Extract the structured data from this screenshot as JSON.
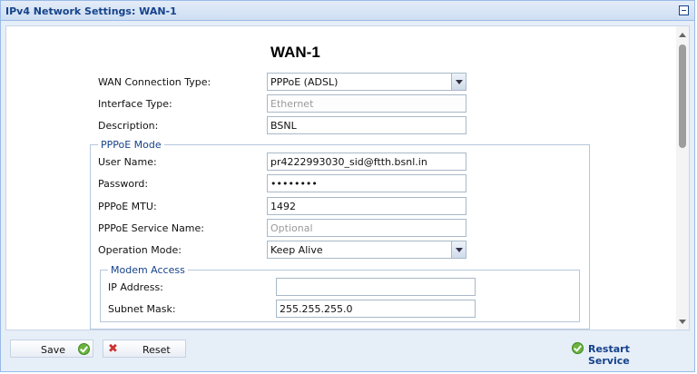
{
  "window": {
    "title": "IPv4 Network Settings: WAN-1"
  },
  "form": {
    "heading": "WAN-1",
    "wan_connection_type": {
      "label": "WAN Connection Type:",
      "value": "PPPoE (ADSL)"
    },
    "interface_type": {
      "label": "Interface Type:",
      "value": "Ethernet"
    },
    "description": {
      "label": "Description:",
      "value": "BSNL"
    }
  },
  "pppoe": {
    "legend": "PPPoE Mode",
    "user_name": {
      "label": "User Name:",
      "value": "pr4222993030_sid@ftth.bsnl.in"
    },
    "password": {
      "label": "Password:",
      "value": "••••••••"
    },
    "mtu": {
      "label": "PPPoE MTU:",
      "value": "1492"
    },
    "service_name": {
      "label": "PPPoE Service Name:",
      "placeholder": "Optional"
    },
    "operation_mode": {
      "label": "Operation Mode:",
      "value": "Keep Alive"
    }
  },
  "modem": {
    "legend": "Modem Access",
    "ip_address": {
      "label": "IP Address:",
      "value": ""
    },
    "subnet_mask": {
      "label": "Subnet Mask:",
      "value": "255.255.255.0"
    }
  },
  "footer": {
    "save_label": "Save",
    "reset_label": "Reset",
    "restart_label": "Restart Service"
  },
  "icons": {
    "save": "check-circle-icon",
    "reset": "x-icon",
    "restart": "check-circle-icon"
  },
  "colors": {
    "title": "#15428b",
    "accent_green": "#6cb33f",
    "reset_red": "#cc3333"
  }
}
